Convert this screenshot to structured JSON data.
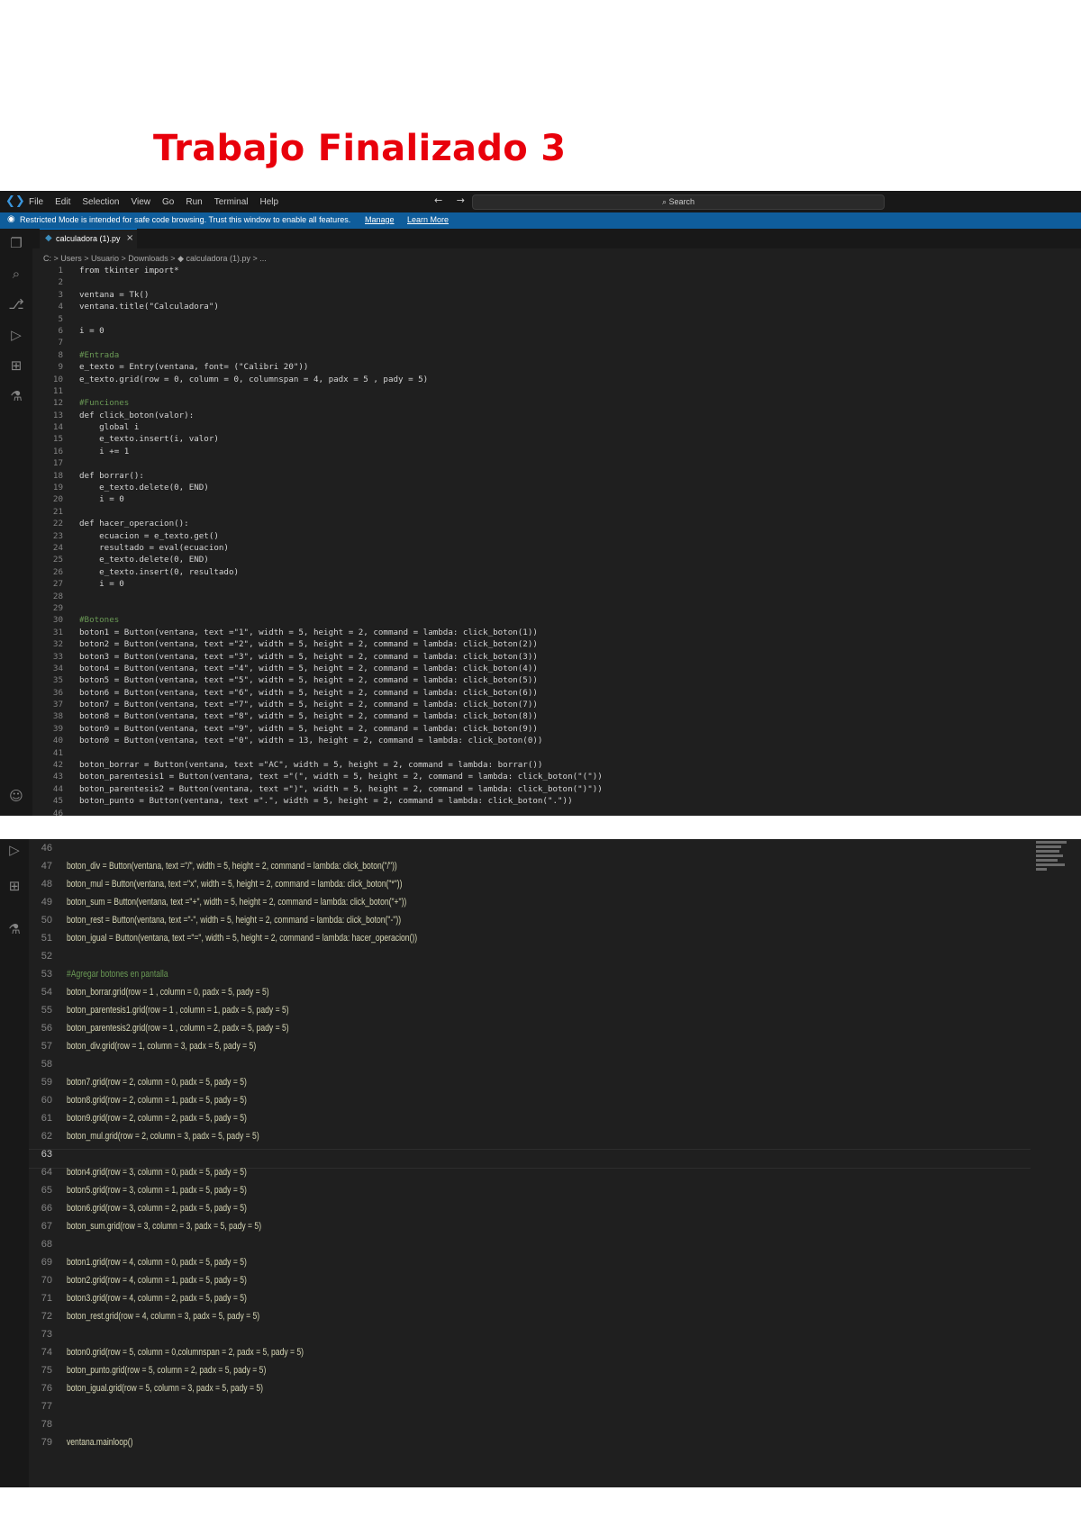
{
  "document": {
    "title": "Trabajo Finalizado 3"
  },
  "editor1": {
    "menu": [
      "File",
      "Edit",
      "Selection",
      "View",
      "Go",
      "Run",
      "Terminal",
      "Help"
    ],
    "nav_arrows": "← →",
    "search_placeholder": "Search",
    "banner": {
      "message": "Restricted Mode is intended for safe code browsing. Trust this window to enable all features.",
      "manage_link": "Manage",
      "learn_more_link": "Learn More"
    },
    "tab": {
      "name": "calculadora (1).py",
      "close": "×"
    },
    "breadcrumb": "C: > Users > Usuario > Downloads > ◆ calculadora (1).py > ...",
    "activity_icons": [
      "explorer-icon",
      "search-icon",
      "source-control-icon",
      "run-debug-icon",
      "extensions-icon",
      "testing-icon",
      "account-icon"
    ],
    "lines": [
      {
        "n": "1",
        "t": "from tkinter import*"
      },
      {
        "n": "2",
        "t": ""
      },
      {
        "n": "3",
        "t": "ventana = Tk()"
      },
      {
        "n": "4",
        "t": "ventana.title(\"Calculadora\")"
      },
      {
        "n": "5",
        "t": ""
      },
      {
        "n": "6",
        "t": "i = 0"
      },
      {
        "n": "7",
        "t": ""
      },
      {
        "n": "8",
        "t": "#Entrada"
      },
      {
        "n": "9",
        "t": "e_texto = Entry(ventana, font= (\"Calibri 20\"))"
      },
      {
        "n": "10",
        "t": "e_texto.grid(row = 0, column = 0, columnspan = 4, padx = 5 , pady = 5)"
      },
      {
        "n": "11",
        "t": ""
      },
      {
        "n": "12",
        "t": "#Funciones"
      },
      {
        "n": "13",
        "t": "def click_boton(valor):"
      },
      {
        "n": "14",
        "t": "    global i"
      },
      {
        "n": "15",
        "t": "    e_texto.insert(i, valor)"
      },
      {
        "n": "16",
        "t": "    i += 1"
      },
      {
        "n": "17",
        "t": ""
      },
      {
        "n": "18",
        "t": "def borrar():"
      },
      {
        "n": "19",
        "t": "    e_texto.delete(0, END)"
      },
      {
        "n": "20",
        "t": "    i = 0"
      },
      {
        "n": "21",
        "t": ""
      },
      {
        "n": "22",
        "t": "def hacer_operacion():"
      },
      {
        "n": "23",
        "t": "    ecuacion = e_texto.get()"
      },
      {
        "n": "24",
        "t": "    resultado = eval(ecuacion)"
      },
      {
        "n": "25",
        "t": "    e_texto.delete(0, END)"
      },
      {
        "n": "26",
        "t": "    e_texto.insert(0, resultado)"
      },
      {
        "n": "27",
        "t": "    i = 0"
      },
      {
        "n": "28",
        "t": ""
      },
      {
        "n": "29",
        "t": ""
      },
      {
        "n": "30",
        "t": "#Botones"
      },
      {
        "n": "31",
        "t": "boton1 = Button(ventana, text =\"1\", width = 5, height = 2, command = lambda: click_boton(1))"
      },
      {
        "n": "32",
        "t": "boton2 = Button(ventana, text =\"2\", width = 5, height = 2, command = lambda: click_boton(2))"
      },
      {
        "n": "33",
        "t": "boton3 = Button(ventana, text =\"3\", width = 5, height = 2, command = lambda: click_boton(3))"
      },
      {
        "n": "34",
        "t": "boton4 = Button(ventana, text =\"4\", width = 5, height = 2, command = lambda: click_boton(4))"
      },
      {
        "n": "35",
        "t": "boton5 = Button(ventana, text =\"5\", width = 5, height = 2, command = lambda: click_boton(5))"
      },
      {
        "n": "36",
        "t": "boton6 = Button(ventana, text =\"6\", width = 5, height = 2, command = lambda: click_boton(6))"
      },
      {
        "n": "37",
        "t": "boton7 = Button(ventana, text =\"7\", width = 5, height = 2, command = lambda: click_boton(7))"
      },
      {
        "n": "38",
        "t": "boton8 = Button(ventana, text =\"8\", width = 5, height = 2, command = lambda: click_boton(8))"
      },
      {
        "n": "39",
        "t": "boton9 = Button(ventana, text =\"9\", width = 5, height = 2, command = lambda: click_boton(9))"
      },
      {
        "n": "40",
        "t": "boton0 = Button(ventana, text =\"0\", width = 13, height = 2, command = lambda: click_boton(0))"
      },
      {
        "n": "41",
        "t": ""
      },
      {
        "n": "42",
        "t": "boton_borrar = Button(ventana, text =\"AC\", width = 5, height = 2, command = lambda: borrar())"
      },
      {
        "n": "43",
        "t": "boton_parentesis1 = Button(ventana, text =\"(\", width = 5, height = 2, command = lambda: click_boton(\"(\"))"
      },
      {
        "n": "44",
        "t": "boton_parentesis2 = Button(ventana, text =\")\", width = 5, height = 2, command = lambda: click_boton(\")\"))"
      },
      {
        "n": "45",
        "t": "boton_punto = Button(ventana, text =\".\", width = 5, height = 2, command = lambda: click_boton(\".\"))"
      },
      {
        "n": "46",
        "t": ""
      }
    ]
  },
  "editor2": {
    "activity_icons": [
      "run-debug-icon",
      "extensions-icon",
      "testing-icon"
    ],
    "lines": [
      {
        "n": "46",
        "t": ""
      },
      {
        "n": "47",
        "t": "boton_div = Button(ventana, text =\"/\", width = 5, height = 2, command = lambda: click_boton(\"/\"))"
      },
      {
        "n": "48",
        "t": "boton_mul = Button(ventana, text =\"x\", width = 5, height = 2, command = lambda: click_boton(\"*\"))"
      },
      {
        "n": "49",
        "t": "boton_sum = Button(ventana, text =\"+\", width = 5, height = 2, command = lambda: click_boton(\"+\"))"
      },
      {
        "n": "50",
        "t": "boton_rest = Button(ventana, text =\"-\", width = 5, height = 2, command = lambda: click_boton(\"-\"))"
      },
      {
        "n": "51",
        "t": "boton_igual = Button(ventana, text =\"=\", width = 5, height = 2, command = lambda: hacer_operacion())"
      },
      {
        "n": "52",
        "t": ""
      },
      {
        "n": "53",
        "t": "#Agregar botones en pantalla"
      },
      {
        "n": "54",
        "t": "boton_borrar.grid(row = 1 , column = 0, padx = 5, pady = 5)"
      },
      {
        "n": "55",
        "t": "boton_parentesis1.grid(row = 1 , column = 1, padx = 5, pady = 5)"
      },
      {
        "n": "56",
        "t": "boton_parentesis2.grid(row = 1 , column = 2, padx = 5, pady = 5)"
      },
      {
        "n": "57",
        "t": "boton_div.grid(row = 1, column = 3, padx = 5, pady = 5)"
      },
      {
        "n": "58",
        "t": ""
      },
      {
        "n": "59",
        "t": "boton7.grid(row = 2, column = 0, padx = 5, pady = 5)"
      },
      {
        "n": "60",
        "t": "boton8.grid(row = 2, column = 1, padx = 5, pady = 5)"
      },
      {
        "n": "61",
        "t": "boton9.grid(row = 2, column = 2, padx = 5, pady = 5)"
      },
      {
        "n": "62",
        "t": "boton_mul.grid(row = 2, column = 3, padx = 5, pady = 5)"
      },
      {
        "n": "63",
        "t": ""
      },
      {
        "n": "64",
        "t": "boton4.grid(row = 3, column = 0, padx = 5, pady = 5)"
      },
      {
        "n": "65",
        "t": "boton5.grid(row = 3, column = 1, padx = 5, pady = 5)"
      },
      {
        "n": "66",
        "t": "boton6.grid(row = 3, column = 2, padx = 5, pady = 5)"
      },
      {
        "n": "67",
        "t": "boton_sum.grid(row = 3, column = 3, padx = 5, pady = 5)"
      },
      {
        "n": "68",
        "t": ""
      },
      {
        "n": "69",
        "t": "boton1.grid(row = 4, column = 0, padx = 5, pady = 5)"
      },
      {
        "n": "70",
        "t": "boton2.grid(row = 4, column = 1, padx = 5, pady = 5)"
      },
      {
        "n": "71",
        "t": "boton3.grid(row = 4, column = 2, padx = 5, pady = 5)"
      },
      {
        "n": "72",
        "t": "boton_rest.grid(row = 4, column = 3, padx = 5, pady = 5)"
      },
      {
        "n": "73",
        "t": ""
      },
      {
        "n": "74",
        "t": "boton0.grid(row = 5, column = 0,columnspan = 2, padx = 5, pady = 5)"
      },
      {
        "n": "75",
        "t": "boton_punto.grid(row = 5, column = 2, padx = 5, pady = 5)"
      },
      {
        "n": "76",
        "t": "boton_igual.grid(row = 5, column = 3, padx = 5, pady = 5)"
      },
      {
        "n": "77",
        "t": ""
      },
      {
        "n": "78",
        "t": ""
      },
      {
        "n": "79",
        "t": "ventana.mainloop()"
      }
    ],
    "active_line": "63"
  }
}
